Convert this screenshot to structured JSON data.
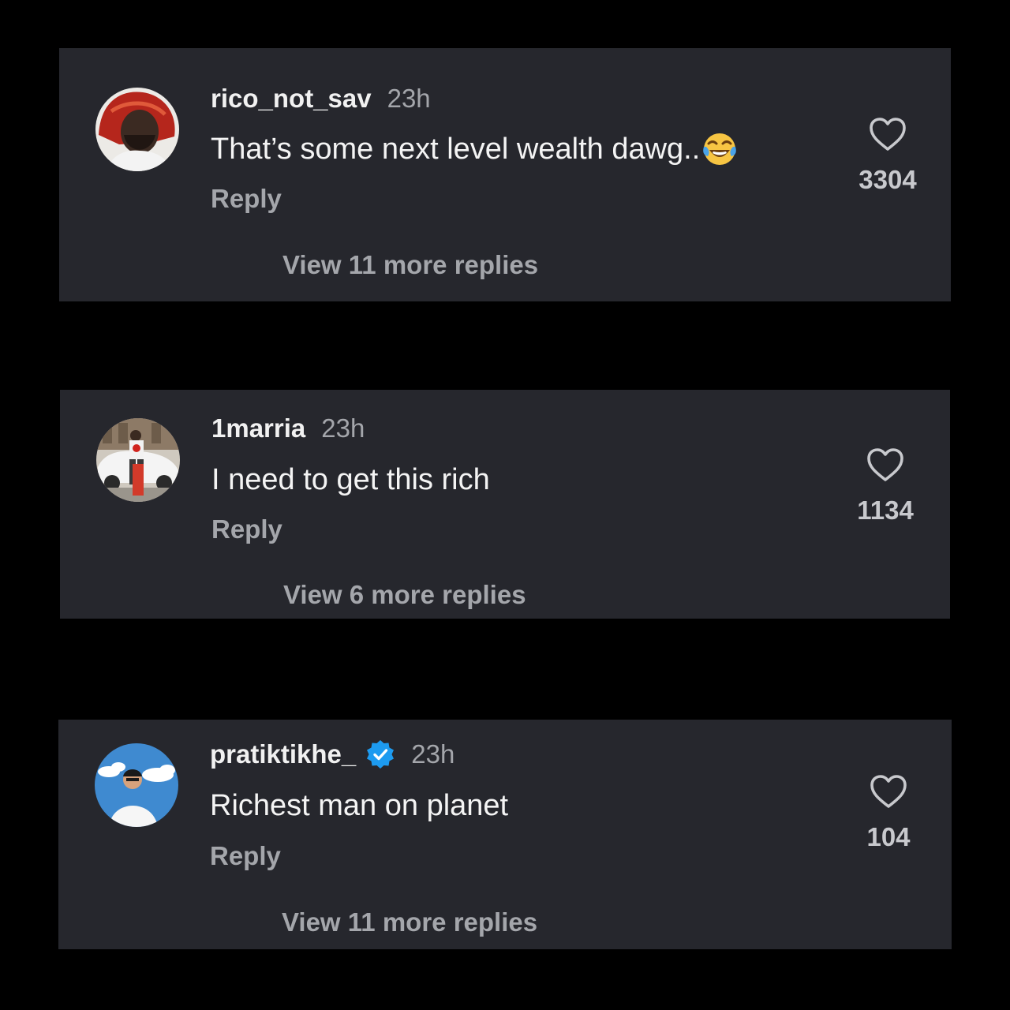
{
  "comments": [
    {
      "username": "rico_not_sav",
      "time": "23h",
      "text": "That’s some next level wealth dawg..",
      "emoji": "tears-of-joy-emoji",
      "reply_label": "Reply",
      "likes": "3304",
      "view_replies": "View 11 more replies",
      "verified": false,
      "avatar": "avatar-red-hood"
    },
    {
      "username": "1marria",
      "time": "23h",
      "text": "I need to get this rich",
      "reply_label": "Reply",
      "likes": "1134",
      "view_replies": "View 6 more replies",
      "verified": false,
      "avatar": "avatar-car-street"
    },
    {
      "username": "pratiktikhe_",
      "time": "23h",
      "text": "Richest man on planet",
      "reply_label": "Reply",
      "likes": "104",
      "view_replies": "View 11 more replies",
      "verified": true,
      "avatar": "avatar-sky-clouds"
    }
  ],
  "colors": {
    "background": "#000000",
    "card": "#26272d",
    "primary_text": "#f4f4f4",
    "secondary_text": "#a4a6ab",
    "verified_blue": "#1d9bf0"
  },
  "icons": {
    "like": "heart-outline-icon",
    "verified": "verified-badge-icon"
  }
}
